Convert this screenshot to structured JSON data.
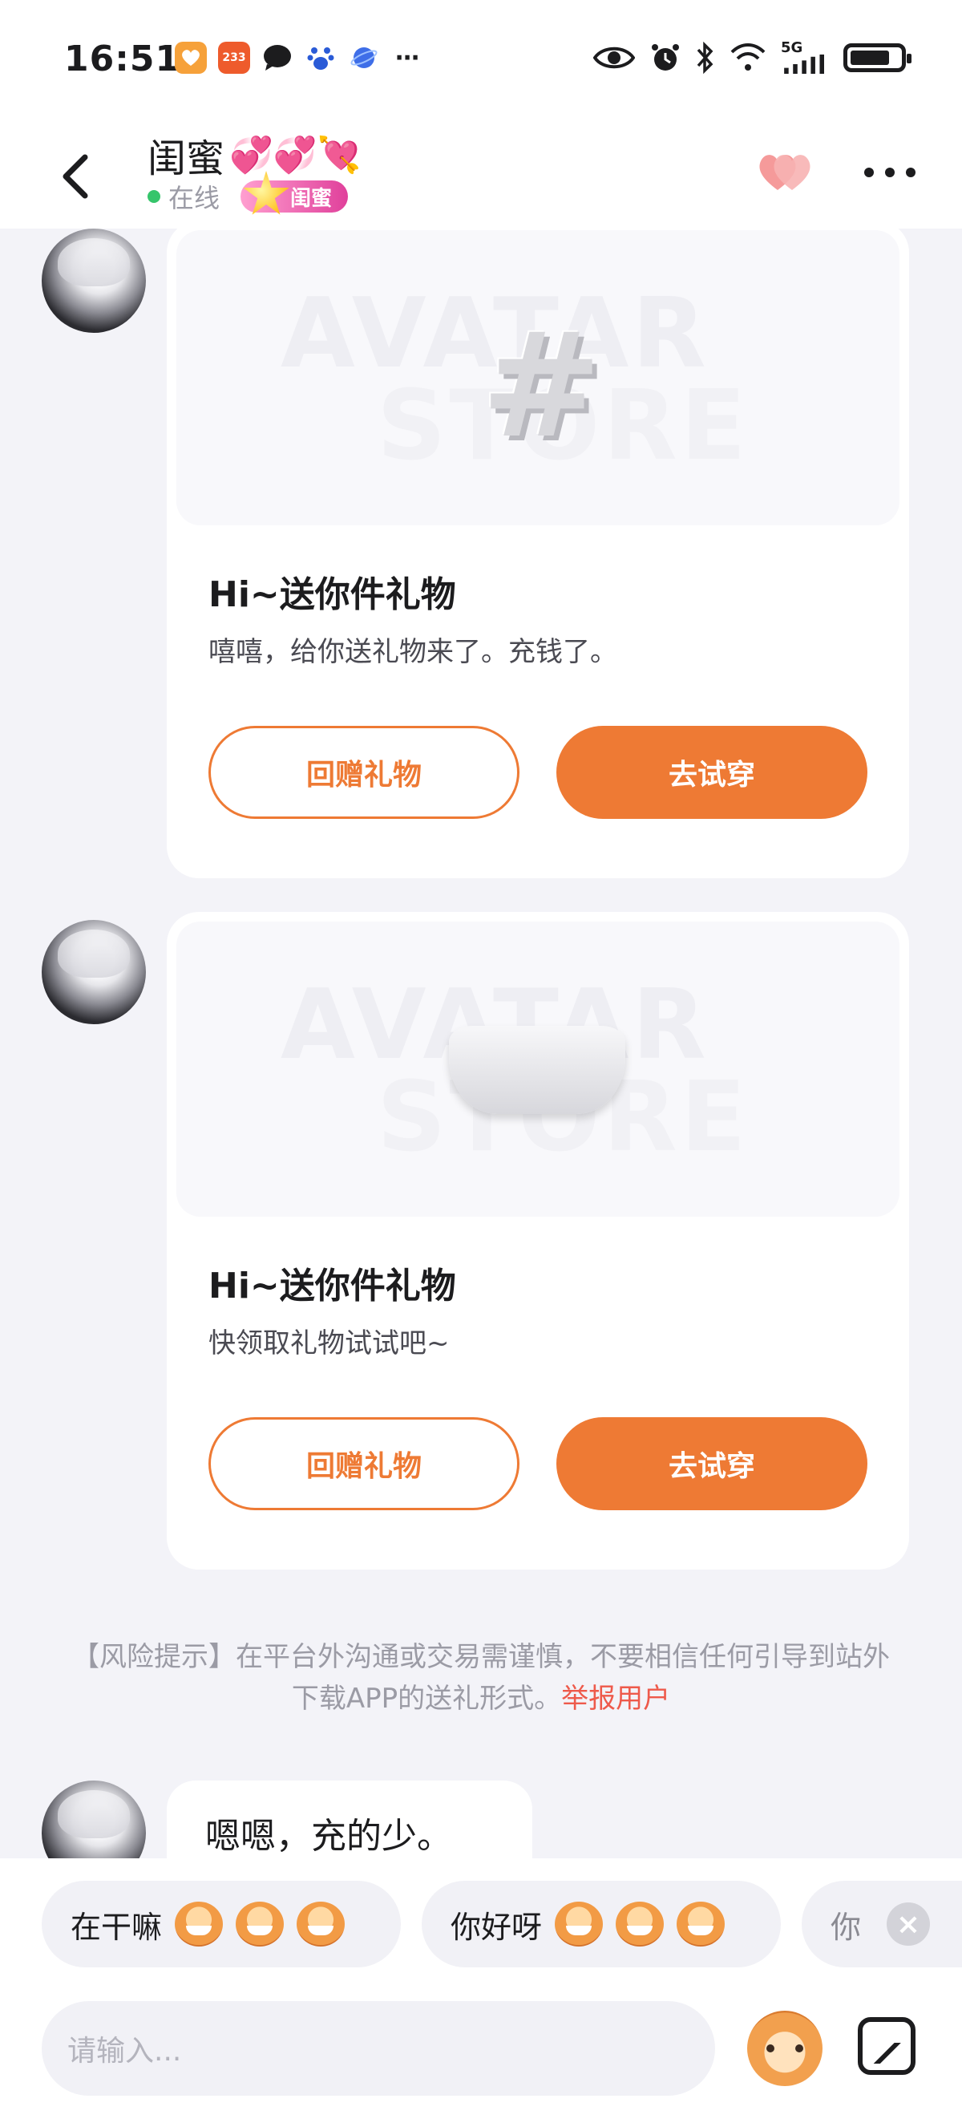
{
  "status_bar": {
    "time": "16:51",
    "app_badge": "233",
    "network": "5G"
  },
  "header": {
    "title": "闺蜜",
    "title_hearts": "💞💞💘",
    "online_text": "在线",
    "relation_badge": "闺蜜"
  },
  "messages": [
    {
      "type": "gift",
      "watermark_line1": "AVATAR",
      "watermark_line2": "STORE",
      "item_icon": "hash-symbol",
      "title": "Hi~送你件礼物",
      "description": "嘻嘻，给你送礼物来了。充钱了。",
      "return_label": "回赠礼物",
      "try_label": "去试穿"
    },
    {
      "type": "gift",
      "watermark_line1": "AVATAR",
      "watermark_line2": "STORE",
      "item_icon": "headband",
      "title": "Hi~送你件礼物",
      "description": "快领取礼物试试吧~",
      "return_label": "回赠礼物",
      "try_label": "去试穿"
    }
  ],
  "risk_notice": {
    "text": "【风险提示】在平台外沟通或交易需谨慎，不要相信任何引导到站外下载APP的送礼形式。",
    "report_link": "举报用户"
  },
  "last_message": "嗯嗯，充的少。",
  "quick_replies": [
    {
      "label": "在干嘛"
    },
    {
      "label": "你好呀"
    },
    {
      "label": "你"
    }
  ],
  "composer": {
    "placeholder": "请输入..."
  },
  "colors": {
    "accent": "#ee7a34",
    "report": "#ee5a4b",
    "online": "#36c56b"
  }
}
